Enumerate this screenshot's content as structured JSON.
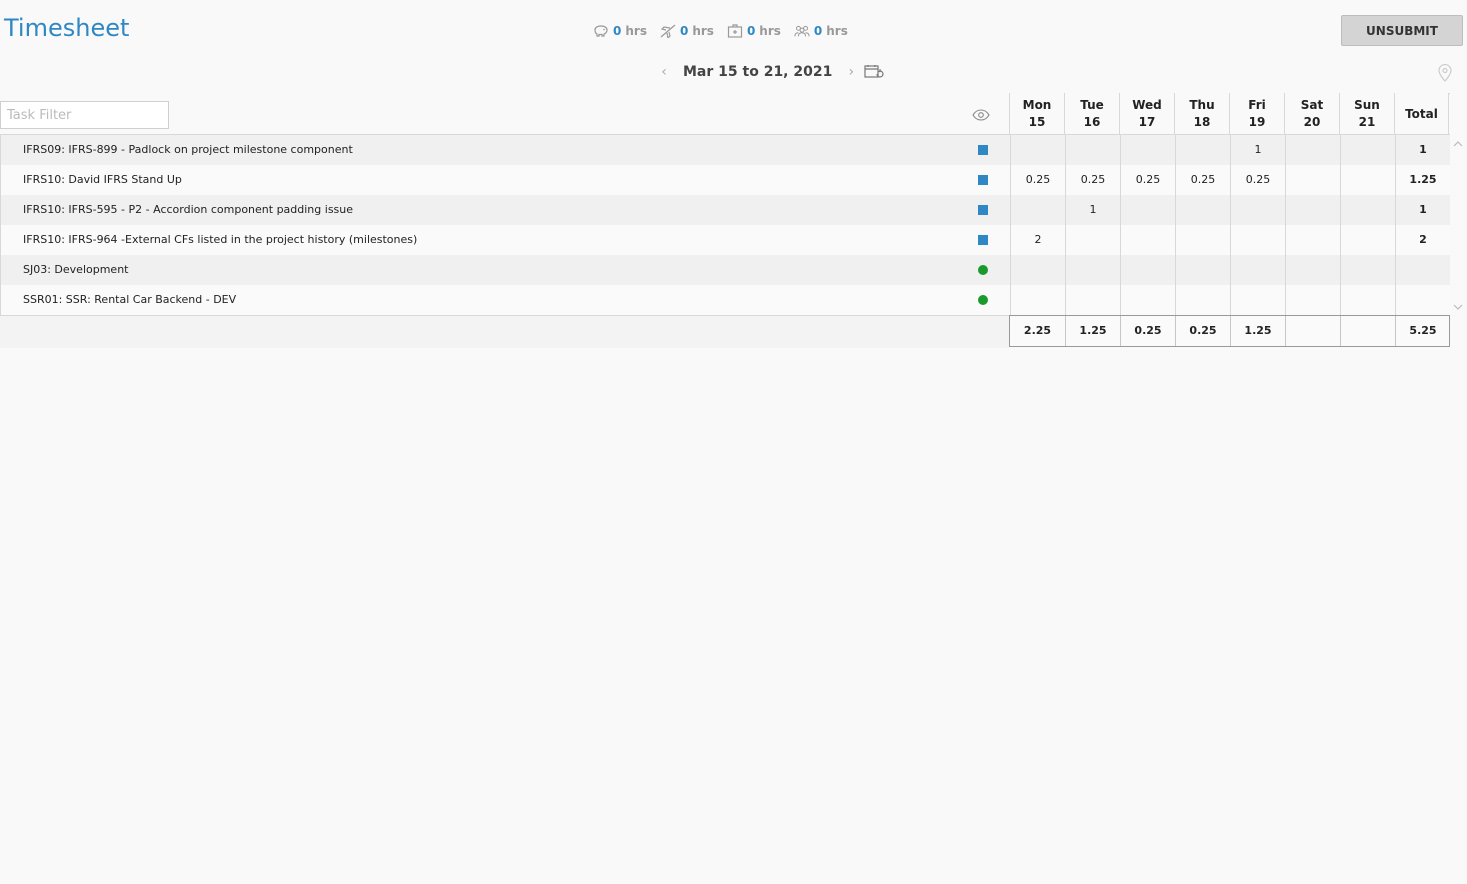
{
  "app": {
    "title": "Timesheet"
  },
  "stats": [
    {
      "icon": "piggy-bank-icon",
      "value": "0",
      "unit": "hrs"
    },
    {
      "icon": "plane-icon",
      "value": "0",
      "unit": "hrs"
    },
    {
      "icon": "medical-kit-icon",
      "value": "0",
      "unit": "hrs"
    },
    {
      "icon": "group-icon",
      "value": "0",
      "unit": "hrs"
    }
  ],
  "actions": {
    "unsubmit_label": "UNSUBMIT"
  },
  "date_nav": {
    "range": "Mar 15 to 21, 2021",
    "prev": "‹",
    "next": "›"
  },
  "filter": {
    "placeholder": "Task Filter",
    "value": ""
  },
  "columns": [
    {
      "day": "Mon",
      "date": "15"
    },
    {
      "day": "Tue",
      "date": "16"
    },
    {
      "day": "Wed",
      "date": "17"
    },
    {
      "day": "Thu",
      "date": "18"
    },
    {
      "day": "Fri",
      "date": "19"
    },
    {
      "day": "Sat",
      "date": "20"
    },
    {
      "day": "Sun",
      "date": "21"
    }
  ],
  "total_label": "Total",
  "tasks": [
    {
      "name": "IFRS09: IFRS-899 - Padlock on project milestone component",
      "marker": "square",
      "hours": [
        "",
        "",
        "",
        "",
        "1",
        "",
        ""
      ],
      "total": "1"
    },
    {
      "name": "IFRS10: David IFRS Stand Up",
      "marker": "square",
      "hours": [
        "0.25",
        "0.25",
        "0.25",
        "0.25",
        "0.25",
        "",
        ""
      ],
      "total": "1.25"
    },
    {
      "name": "IFRS10: IFRS-595 - P2 - Accordion component padding issue",
      "marker": "square",
      "hours": [
        "",
        "1",
        "",
        "",
        "",
        "",
        ""
      ],
      "total": "1"
    },
    {
      "name": "IFRS10: IFRS-964 -External CFs listed in the project history (milestones)",
      "marker": "square",
      "hours": [
        "2",
        "",
        "",
        "",
        "",
        "",
        ""
      ],
      "total": "2"
    },
    {
      "name": "SJ03: Development",
      "marker": "dot",
      "hours": [
        "",
        "",
        "",
        "",
        "",
        "",
        ""
      ],
      "total": ""
    },
    {
      "name": "SSR01: SSR: Rental Car Backend - DEV",
      "marker": "dot",
      "hours": [
        "",
        "",
        "",
        "",
        "",
        "",
        ""
      ],
      "total": ""
    }
  ],
  "totals": [
    "2.25",
    "1.25",
    "0.25",
    "0.25",
    "1.25",
    "",
    ""
  ],
  "grand_total": "5.25",
  "colors": {
    "accent": "#2f88c4",
    "green": "#1a9a2a"
  }
}
